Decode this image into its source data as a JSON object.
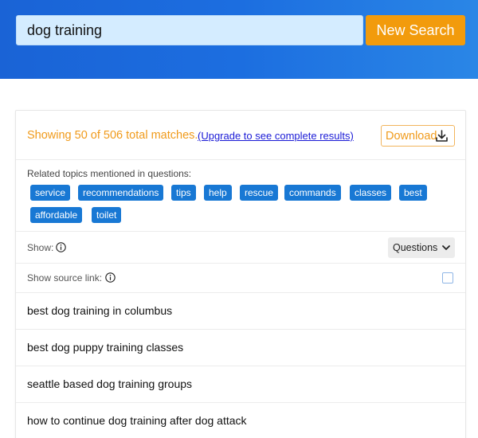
{
  "search": {
    "value": "dog training",
    "button_label": "New Search"
  },
  "summary": {
    "text": "Showing 50 of 506 total matches.",
    "upgrade_link": "(Upgrade to see complete results)",
    "download_label": "Download"
  },
  "topics": {
    "label": "Related topics mentioned in questions:",
    "tags": [
      "service",
      "recommendations",
      "tips",
      "help",
      "rescue",
      "commands",
      "classes",
      "best",
      "affordable",
      "toilet"
    ]
  },
  "show": {
    "label": "Show:",
    "selected": "Questions"
  },
  "source": {
    "label": "Show source link:"
  },
  "results": [
    "best dog training in columbus",
    "best dog puppy training classes",
    "seattle based dog training groups",
    "how to continue dog training after dog attack"
  ],
  "colors": {
    "header_blue": "#1c6ee0",
    "accent_orange": "#f29b0c",
    "tag_blue": "#1878d4",
    "link_blue": "#1a1ad6"
  },
  "icons": [
    "download-icon",
    "info-icon",
    "chevron-down-icon"
  ]
}
